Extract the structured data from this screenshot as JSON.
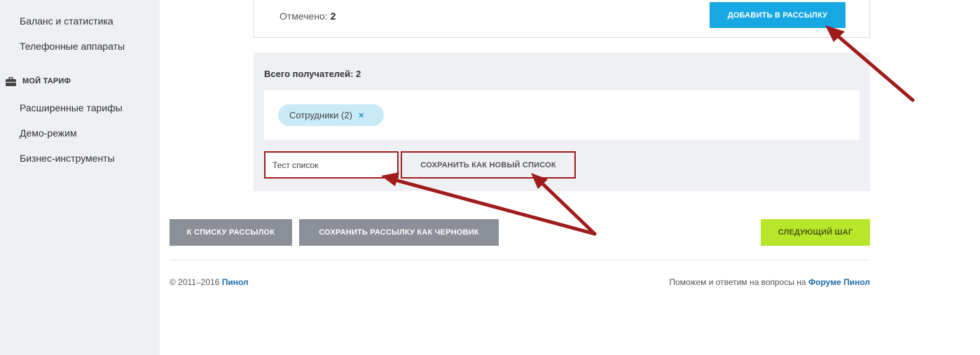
{
  "sidebar": {
    "links": [
      {
        "label": "Баланс и статистика"
      },
      {
        "label": "Телефонные аппараты"
      }
    ],
    "section": {
      "label": "МОЙ ТАРИФ",
      "icon": "briefcase-icon"
    },
    "section_links": [
      {
        "label": "Расширенные тарифы"
      },
      {
        "label": "Демо-режим"
      },
      {
        "label": "Бизнес-инструменты"
      }
    ]
  },
  "selection": {
    "marked_label": "Отмечено:",
    "marked_count": "2",
    "add_button": "ДОБАВИТЬ В РАССЫЛКУ"
  },
  "recipients": {
    "total_label": "Всего получателей: 2",
    "tags": [
      {
        "label": "Сотрудники (2)",
        "remove": "×"
      }
    ],
    "list_name_value": "Тест список",
    "save_list_button": "СОХРАНИТЬ КАК НОВЫЙ СПИСОК"
  },
  "actions": {
    "back_button": "К СПИСКУ РАССЫЛОК",
    "draft_button": "СОХРАНИТЬ РАССЫЛКУ КАК ЧЕРНОВИК",
    "next_button": "СЛЕДУЮЩИЙ ШАГ"
  },
  "footer": {
    "copyright": "© 2011–2016 ",
    "brand": "Пинол",
    "help_text": "Поможем и ответим на вопросы на ",
    "forum_link": "Форуме Пинол"
  },
  "colors": {
    "accent_blue": "#17a8e3",
    "next_green": "#b7e62a",
    "annotation_red": "#a01c1c",
    "secondary_gray": "#8a8f98"
  }
}
